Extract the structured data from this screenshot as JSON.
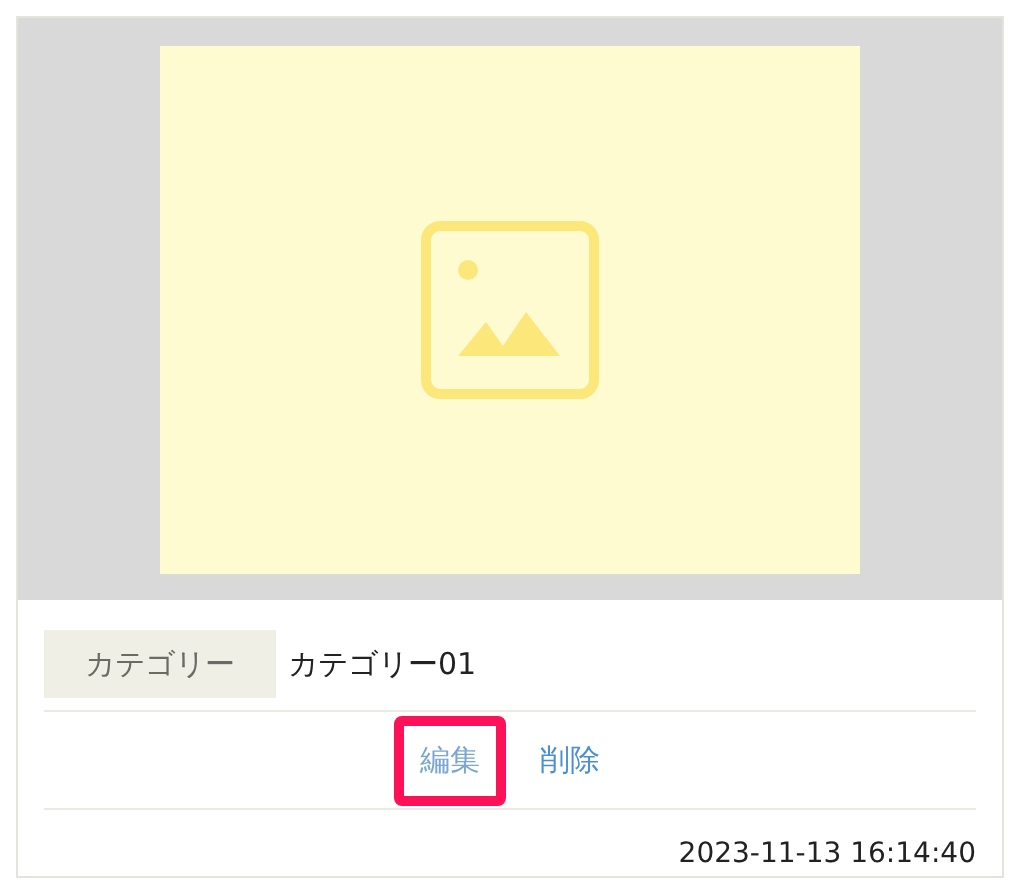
{
  "card": {
    "image": {
      "kind": "placeholder"
    },
    "category": {
      "label": "カテゴリー",
      "value": "カテゴリー01"
    },
    "actions": [
      {
        "label": "編集",
        "highlighted": true
      },
      {
        "label": "削除",
        "highlighted": false
      }
    ],
    "date": "2023-11-13 16:14:40"
  }
}
